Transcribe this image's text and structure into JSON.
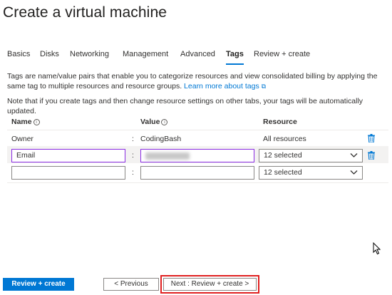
{
  "header": {
    "title": "Create a virtual machine",
    "more": "···"
  },
  "tabs": [
    {
      "label": "Basics",
      "active": false
    },
    {
      "label": "Disks",
      "active": false
    },
    {
      "label": "Networking",
      "active": false
    },
    {
      "label": "Management",
      "active": false
    },
    {
      "label": "Advanced",
      "active": false
    },
    {
      "label": "Tags",
      "active": true
    },
    {
      "label": "Review + create",
      "active": false
    }
  ],
  "description": {
    "line1": "Tags are name/value pairs that enable you to categorize resources and view consolidated billing by applying the same tag to multiple resources and resource groups.",
    "link": "Learn more about tags",
    "external_icon": "⧉",
    "line2": "Note that if you create tags and then change resource settings on other tabs, your tags will be automatically updated."
  },
  "table": {
    "headers": {
      "name": "Name",
      "value": "Value",
      "resource": "Resource",
      "info_glyph": "i"
    },
    "separator": ":",
    "rows": [
      {
        "name": "Owner",
        "value": "CodingBash",
        "resource": "All resources",
        "editable": false
      },
      {
        "name": "Email",
        "value": "",
        "resource": "12 selected",
        "editable": true
      },
      {
        "name": "",
        "value": "",
        "resource": "12 selected",
        "editable": true
      }
    ]
  },
  "icons": {
    "delete": "trash-icon",
    "dropdown": "chevron-down-icon",
    "cursor": "mouse-cursor-icon"
  },
  "footer": {
    "review_create": "Review + create",
    "previous": "< Previous",
    "next": "Next : Review + create >"
  },
  "colors": {
    "accent": "#0078d4",
    "focus_border": "#8a2be2",
    "highlight_box": "#e02020"
  }
}
